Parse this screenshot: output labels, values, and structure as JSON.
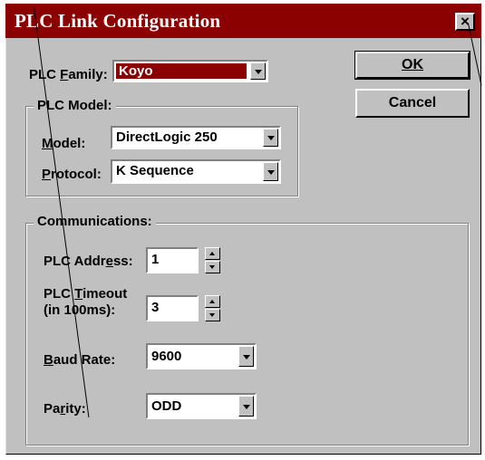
{
  "window": {
    "title": "PLC Link Configuration",
    "close_glyph": "×"
  },
  "buttons": {
    "ok": "OK",
    "cancel": "Cancel"
  },
  "plc_family": {
    "label_prefix": "PLC ",
    "label_key": "F",
    "label_suffix": "amily:",
    "value": "Koyo"
  },
  "plc_model": {
    "group_title": "PLC Model:",
    "model": {
      "label_key": "M",
      "label_suffix": "odel:",
      "value": "DirectLogic 250"
    },
    "protocol": {
      "label_key": "P",
      "label_suffix": "rotocol:",
      "value": "K Sequence"
    }
  },
  "communications": {
    "group_title": "Communications:",
    "plc_address": {
      "label_prefix": "PLC Addr",
      "label_key": "e",
      "label_suffix": "ss:",
      "value": "1"
    },
    "plc_timeout": {
      "label_line1_prefix": "PLC ",
      "label_line1_key": "T",
      "label_line1_suffix": "imeout",
      "label_line2": "(in 100ms):",
      "value": "3"
    },
    "baud_rate": {
      "label_key": "B",
      "label_suffix": "aud Rate:",
      "value": "9600"
    },
    "parity": {
      "label_prefix": "Pa",
      "label_key": "r",
      "label_suffix": "ity:",
      "value": "ODD"
    }
  },
  "colors": {
    "titlebar": "#8b0000",
    "dialog_face": "#c0c0c0",
    "selection": "#8b0000"
  },
  "icons": {
    "close": "close-icon",
    "dropdown": "chevron-down-icon",
    "spin_up": "arrow-up-icon",
    "spin_down": "arrow-down-icon"
  }
}
